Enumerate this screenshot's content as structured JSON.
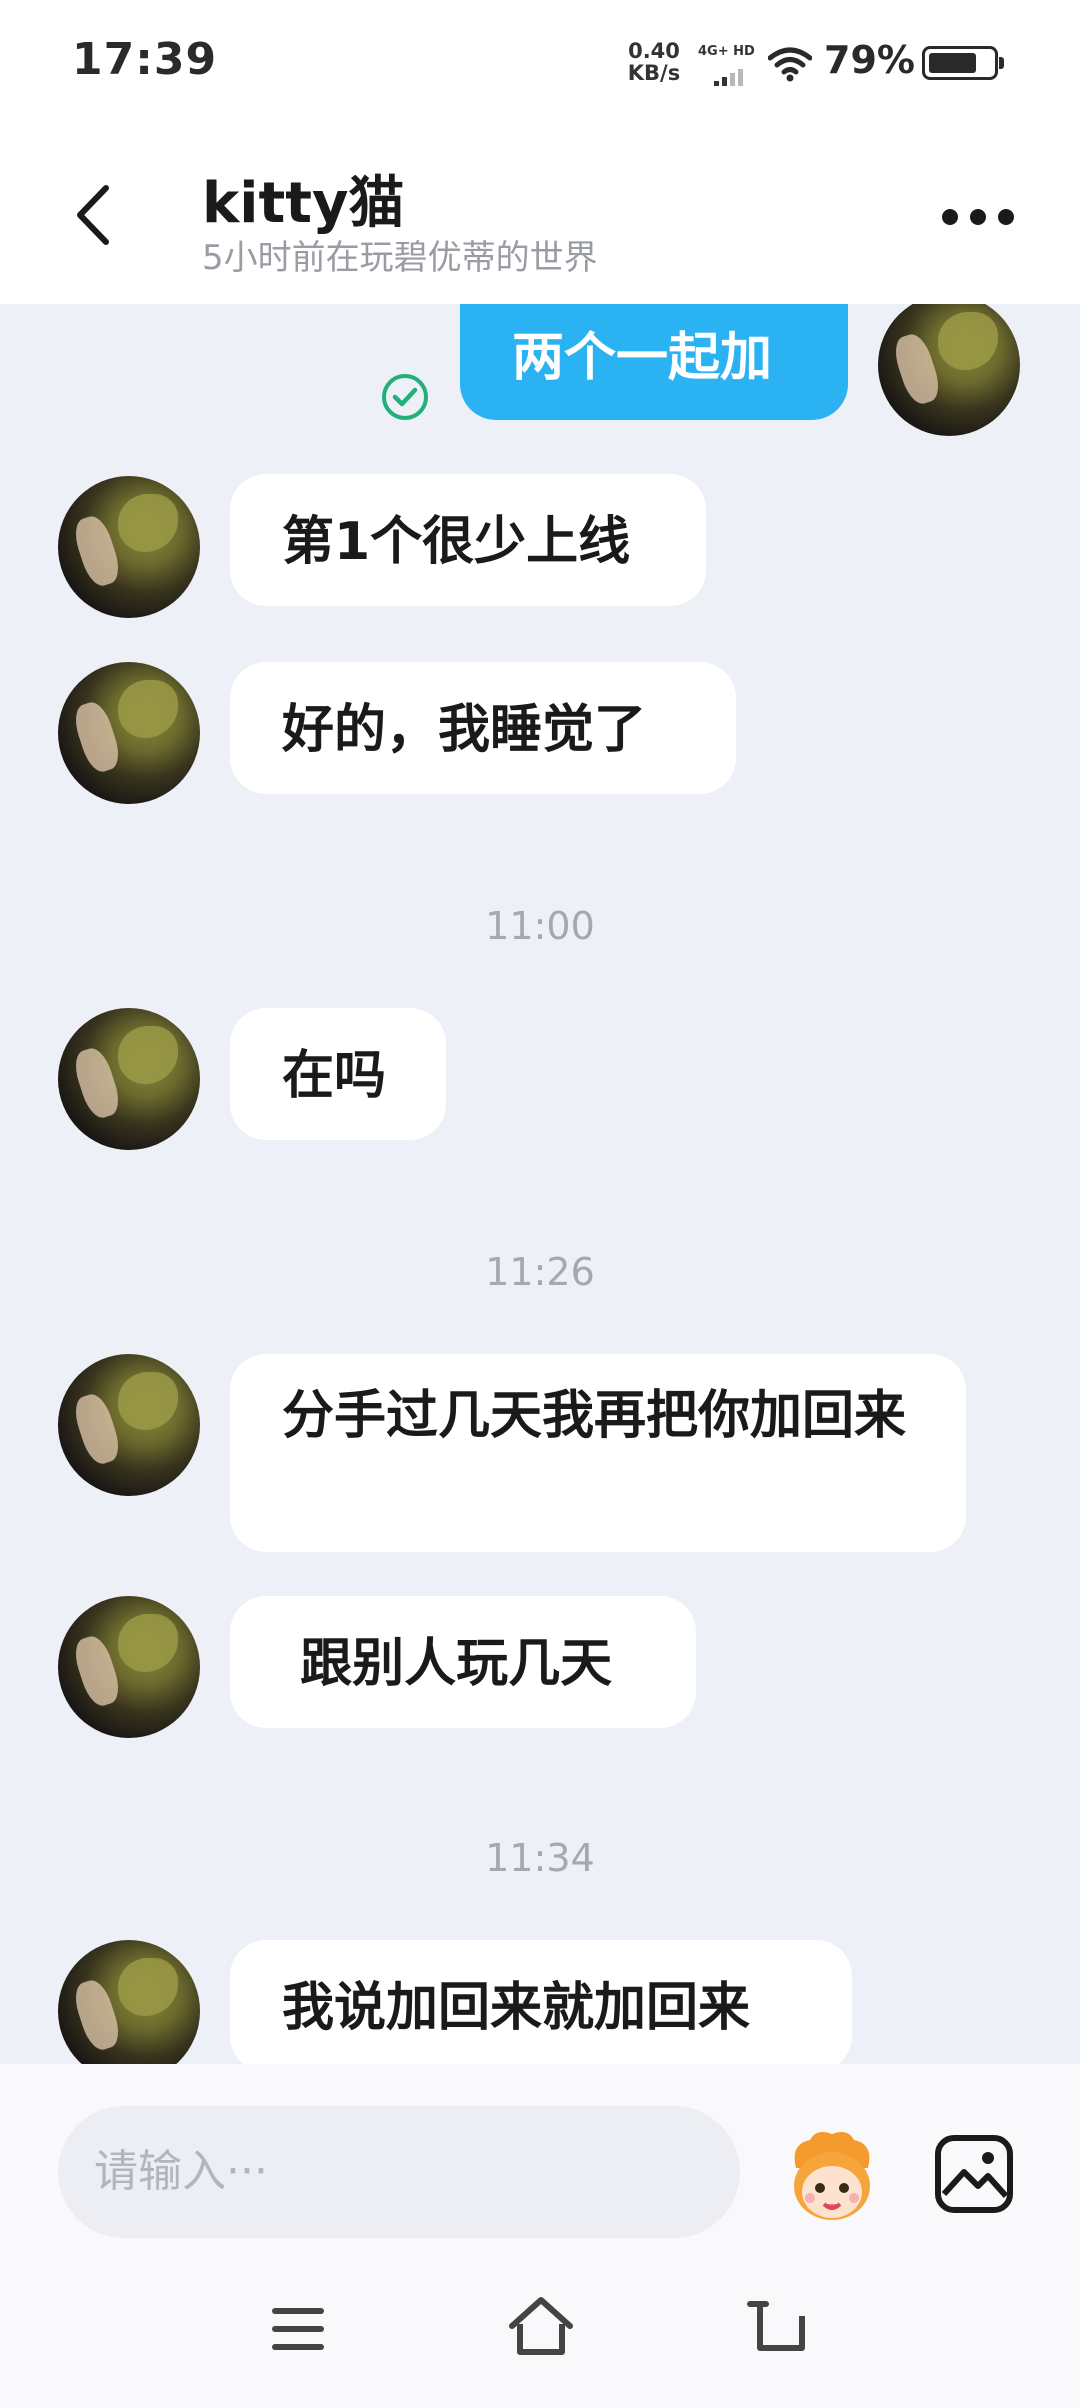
{
  "status_bar": {
    "time": "17:39",
    "speed_value": "0.40",
    "speed_unit": "KB/s",
    "network": "4G+ HD",
    "battery": "79%",
    "battery_level": 0.79,
    "wifi_icon": "wifi-icon",
    "battery_icon": "battery-icon"
  },
  "header": {
    "title": "kitty猫",
    "subtitle": "5小时前在玩碧优蒂的世界",
    "back_icon": "chevron-left-icon",
    "more_icon": "more-dots-icon"
  },
  "messages": [
    {
      "sender": "me",
      "text": "两个一起加",
      "read_icon": "check-circle-icon"
    },
    {
      "sender": "them",
      "text": "第1个很少上线"
    },
    {
      "sender": "them",
      "text": "好的，我睡觉了"
    },
    {
      "timestamp": "11:00"
    },
    {
      "sender": "them",
      "text": "在吗"
    },
    {
      "timestamp": "11:26"
    },
    {
      "sender": "them",
      "text": "分手过几天我再把你加回来"
    },
    {
      "sender": "them",
      "text": " 跟别人玩几天"
    },
    {
      "timestamp": "11:34"
    },
    {
      "sender": "them",
      "text": "我说加回来就加回来"
    }
  ],
  "input_bar": {
    "placeholder": "请输入···",
    "emoji_icon": "mascot-emoji-icon",
    "image_icon": "image-icon"
  },
  "nav_bar": {
    "menu_icon": "menu-icon",
    "home_icon": "home-icon",
    "back_icon": "back-icon"
  },
  "colors": {
    "accent": "#2ab2f2",
    "chat_bg": "#eef0f7",
    "read_check": "#22b07a"
  }
}
